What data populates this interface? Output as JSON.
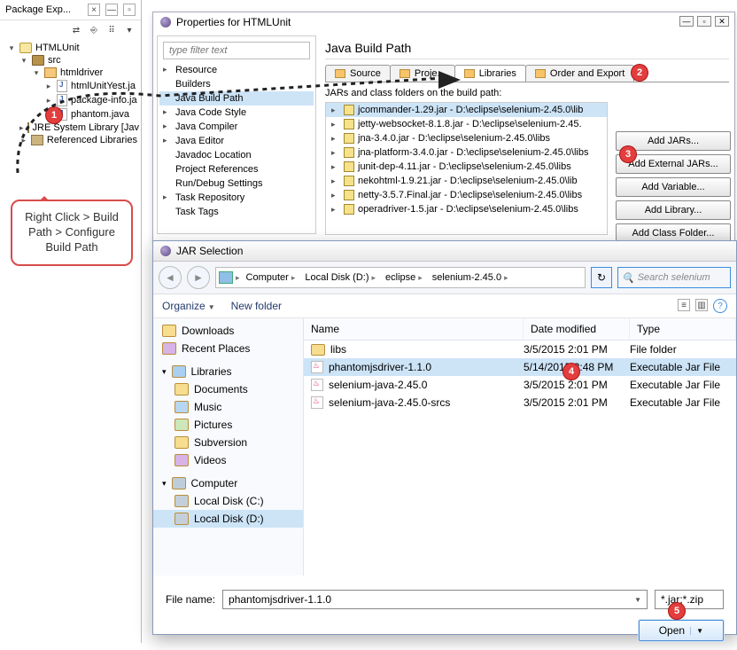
{
  "pkg": {
    "title": "Package Exp...",
    "close": "×",
    "tree": {
      "root": "HTMLUnit",
      "src": "src",
      "pkg": "htmldriver",
      "files": [
        "htmlUnitYest.ja",
        "package-info.ja",
        "phantom.java"
      ],
      "jre": "JRE System Library [Jav",
      "refs": "Referenced Libraries"
    }
  },
  "callout": "Right Click > Build Path > Configure Build Path",
  "props": {
    "title": "Properties for HTMLUnit",
    "filter": "type filter text",
    "cats": [
      "Resource",
      "Builders",
      "Java Build Path",
      "Java Code Style",
      "Java Compiler",
      "Java Editor",
      "Javadoc Location",
      "Project References",
      "Run/Debug Settings",
      "Task Repository",
      "Task Tags"
    ],
    "heading": "Java Build Path",
    "tabs": [
      "Source",
      "Proje...",
      "Libraries",
      "Order and Export"
    ],
    "jarLabel": "JARs and class folders on the build path:",
    "jars": [
      "jcommander-1.29.jar - D:\\eclipse\\selenium-2.45.0\\lib",
      "jetty-websocket-8.1.8.jar - D:\\eclipse\\selenium-2.45.",
      "jna-3.4.0.jar - D:\\eclipse\\selenium-2.45.0\\libs",
      "jna-platform-3.4.0.jar - D:\\eclipse\\selenium-2.45.0\\libs",
      "junit-dep-4.11.jar - D:\\eclipse\\selenium-2.45.0\\libs",
      "nekohtml-1.9.21.jar - D:\\eclipse\\selenium-2.45.0\\lib",
      "netty-3.5.7.Final.jar - D:\\eclipse\\selenium-2.45.0\\libs",
      "operadriver-1.5.jar - D:\\eclipse\\selenium-2.45.0\\libs"
    ],
    "btns": [
      "Add JARs...",
      "Add External JARs...",
      "Add Variable...",
      "Add Library...",
      "Add Class Folder..."
    ]
  },
  "jarsel": {
    "title": "JAR Selection",
    "crumbs": [
      "Computer",
      "Local Disk (D:)",
      "eclipse",
      "selenium-2.45.0"
    ],
    "search": "Search selenium",
    "organize": "Organize",
    "newFolder": "New folder",
    "hdr": {
      "name": "Name",
      "date": "Date modified",
      "type": "Type"
    },
    "side": {
      "items": [
        "Downloads",
        "Recent Places"
      ],
      "libHead": "Libraries",
      "libs": [
        "Documents",
        "Music",
        "Pictures",
        "Subversion",
        "Videos"
      ],
      "compHead": "Computer",
      "drives": [
        "Local Disk (C:)",
        "Local Disk (D:)"
      ]
    },
    "rows": [
      {
        "name": "libs",
        "date": "3/5/2015 2:01 PM",
        "type": "File folder",
        "folder": true
      },
      {
        "name": "phantomjsdriver-1.1.0",
        "date": "5/14/2015 3:48 PM",
        "type": "Executable Jar File"
      },
      {
        "name": "selenium-java-2.45.0",
        "date": "3/5/2015 2:01 PM",
        "type": "Executable Jar File"
      },
      {
        "name": "selenium-java-2.45.0-srcs",
        "date": "3/5/2015 2:01 PM",
        "type": "Executable Jar File"
      }
    ],
    "fnLabel": "File name:",
    "fnValue": "phantomjsdriver-1.1.0",
    "filter": "*.jar;*.zip",
    "open": "Open"
  }
}
